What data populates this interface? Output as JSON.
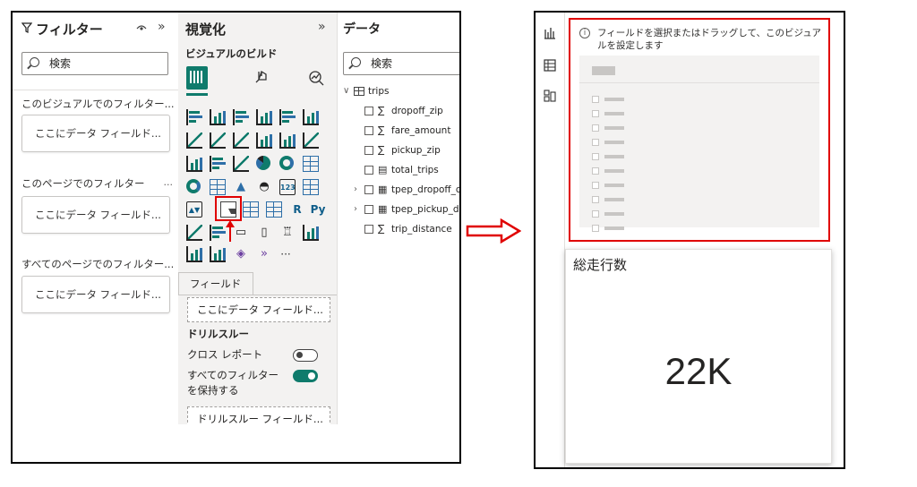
{
  "filters": {
    "title": "フィルター",
    "search_placeholder": "検索",
    "sections": [
      {
        "label": "このビジュアルでのフィルター...",
        "dots": "",
        "drop": "ここにデータ フィールド..."
      },
      {
        "label": "このページでのフィルター",
        "dots": "...",
        "drop": "ここにデータ フィールド..."
      },
      {
        "label": "すべてのページでのフィルター...",
        "dots": "",
        "drop": "ここにデータ フィールド..."
      }
    ]
  },
  "visualizations": {
    "title": "視覚化",
    "subtitle": "ビジュアルのビルド",
    "fields_tab": "フィールド",
    "field_drop": "ここにデータ フィールド...",
    "drillthrough": {
      "title": "ドリルスルー",
      "cross_report": "クロス レポート",
      "keep_filters_line1": "すべてのフィルター",
      "keep_filters_line2": "を保持する",
      "drop": "ドリルスルー フィールド..."
    },
    "glyphs": {
      "r": "R",
      "py": "Py",
      "num": "123",
      "more": "···"
    }
  },
  "data": {
    "title": "データ",
    "search_placeholder": "検索",
    "table_name": "trips",
    "fields": [
      {
        "name": "dropoff_zip",
        "type": "sigma",
        "expand": false
      },
      {
        "name": "fare_amount",
        "type": "sigma",
        "expand": false
      },
      {
        "name": "pickup_zip",
        "type": "sigma",
        "expand": false
      },
      {
        "name": "total_trips",
        "type": "calc",
        "expand": false
      },
      {
        "name": "tpep_dropoff_da",
        "type": "date",
        "expand": true
      },
      {
        "name": "tpep_pickup_dat",
        "type": "date",
        "expand": true
      },
      {
        "name": "trip_distance",
        "type": "sigma",
        "expand": false
      }
    ]
  },
  "slicer": {
    "info": "フィールドを選択またはドラッグして、このビジュアルを設定します"
  },
  "card": {
    "title": "総走行数",
    "value": "22K"
  },
  "colors": {
    "accent": "#0f7b6c",
    "highlight": "#e00000"
  }
}
